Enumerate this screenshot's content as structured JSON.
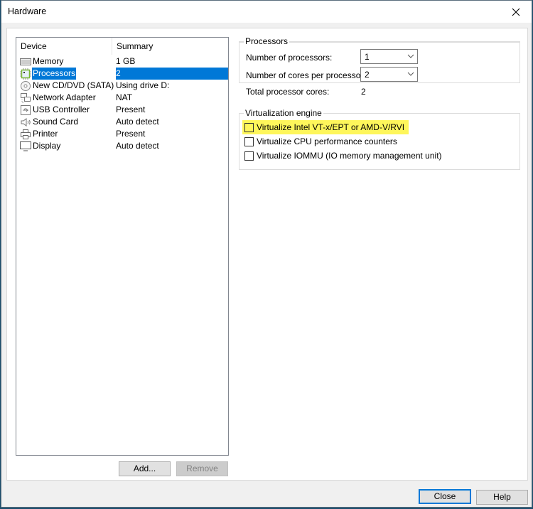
{
  "window": {
    "title": "Hardware",
    "close_icon": "close-x-icon"
  },
  "device_list": {
    "columns": [
      "Device",
      "Summary"
    ],
    "items": [
      {
        "device": "Memory",
        "summary": "1 GB",
        "icon": "memory-icon",
        "selected": false
      },
      {
        "device": "Processors",
        "summary": "2",
        "icon": "processor-icon",
        "selected": true
      },
      {
        "device": "New CD/DVD (SATA)",
        "summary": "Using drive D:",
        "icon": "cd-dvd-icon",
        "selected": false
      },
      {
        "device": "Network Adapter",
        "summary": "NAT",
        "icon": "network-icon",
        "selected": false
      },
      {
        "device": "USB Controller",
        "summary": "Present",
        "icon": "usb-icon",
        "selected": false
      },
      {
        "device": "Sound Card",
        "summary": "Auto detect",
        "icon": "speaker-icon",
        "selected": false
      },
      {
        "device": "Printer",
        "summary": "Present",
        "icon": "printer-icon",
        "selected": false
      },
      {
        "device": "Display",
        "summary": "Auto detect",
        "icon": "monitor-icon",
        "selected": false
      }
    ],
    "add_label": "Add...",
    "remove_label": "Remove"
  },
  "processors_group": {
    "title": "Processors",
    "num_processors_label": "Number of processors:",
    "num_processors_value": "1",
    "cores_label": "Number of cores per processor:",
    "cores_value": "2",
    "total_label": "Total processor cores:",
    "total_value": "2"
  },
  "virtualization_group": {
    "title": "Virtualization engine",
    "options": [
      {
        "label": "Virtualize Intel VT-x/EPT or AMD-V/RVI",
        "checked": false,
        "highlighted": true
      },
      {
        "label": "Virtualize CPU performance counters",
        "checked": false,
        "highlighted": false
      },
      {
        "label": "Virtualize IOMMU (IO memory management unit)",
        "checked": false,
        "highlighted": false
      }
    ],
    "highlight_color": "#fef65b"
  },
  "footer": {
    "close_label": "Close",
    "help_label": "Help"
  },
  "colors": {
    "selection": "#0078d7",
    "default_button_border": "#0078d7"
  }
}
